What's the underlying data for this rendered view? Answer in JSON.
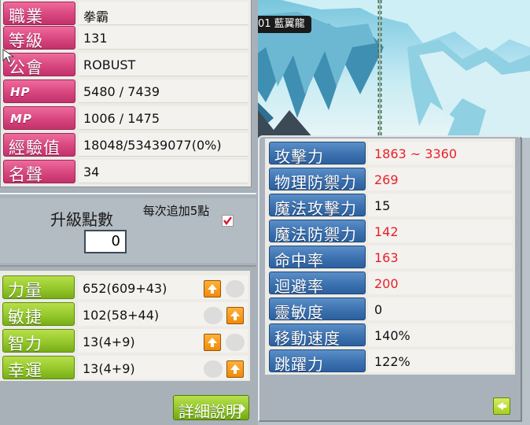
{
  "scene": {
    "map_badge": "01 藍翼龍"
  },
  "character": {
    "rows": [
      {
        "label": "職業",
        "value": "拳霸"
      },
      {
        "label": "等級",
        "value": "131"
      },
      {
        "label": "公會",
        "value": "ROBUST"
      },
      {
        "label": "HP",
        "value": "5480 / 7439"
      },
      {
        "label": "MP",
        "value": "1006 / 1475"
      },
      {
        "label": "經驗值",
        "value": "18048/53439077(0%)"
      },
      {
        "label": "名聲",
        "value": "34"
      }
    ]
  },
  "ability_points": {
    "title": "升級點數",
    "value": "0",
    "auto_assign_label": "每次追加5點",
    "auto_assign_checked": true
  },
  "abilities": [
    {
      "label": "力量",
      "value": "652(609+43)"
    },
    {
      "label": "敏捷",
      "value": "102(58+44)"
    },
    {
      "label": "智力",
      "value": "13(4+9)"
    },
    {
      "label": "幸運",
      "value": "13(4+9)"
    }
  ],
  "detail_button": "詳細說明",
  "details": [
    {
      "label": "攻擊力",
      "value": "1863 ~ 3360",
      "color": "red"
    },
    {
      "label": "物理防禦力",
      "value": "269",
      "color": "red"
    },
    {
      "label": "魔法攻擊力",
      "value": "15",
      "color": "black"
    },
    {
      "label": "魔法防禦力",
      "value": "142",
      "color": "red"
    },
    {
      "label": "命中率",
      "value": "163",
      "color": "red"
    },
    {
      "label": "迴避率",
      "value": "200",
      "color": "red"
    },
    {
      "label": "靈敏度",
      "value": "0",
      "color": "black"
    },
    {
      "label": "移動速度",
      "value": "140%",
      "color": "black"
    },
    {
      "label": "跳躍力",
      "value": "122%",
      "color": "black"
    }
  ],
  "colors": {
    "value_red": "#e8202a",
    "label_pink": "#d8467f",
    "label_green": "#95c82b",
    "label_blue": "#3c72b0"
  }
}
